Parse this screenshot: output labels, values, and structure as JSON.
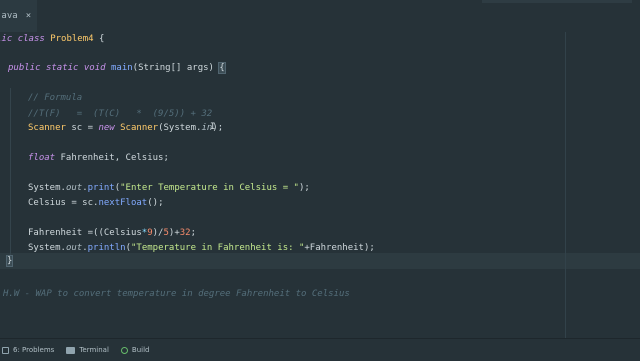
{
  "tab": {
    "name": "java",
    "close": "×"
  },
  "code": {
    "l1": {
      "a": "lic",
      "b": "class",
      "c": "Problem4",
      "d": "{"
    },
    "l2": {
      "a": "public",
      "b": "static",
      "c": "void",
      "d": "main",
      "e": "(String[] args)",
      "f": "{"
    },
    "c1": "// Formula",
    "c2": "//T(F)   =  (T(C)   *  (9/5)) + 32",
    "scanner": {
      "t": "Scanner",
      "v": " sc = ",
      "n": "new",
      "c": "Scanner",
      "a": "(System.",
      "in": "in",
      "e": ");"
    },
    "decl": {
      "t": "float",
      "v": " Fahrenheit, Celsius;"
    },
    "print": {
      "s": "System.",
      "o": "out",
      "d": ".",
      "m": "print",
      "p": "(",
      "str": "\"Enter Temperature in Celsius = \"",
      "e": ");"
    },
    "read": {
      "v": "Celsius = sc.",
      "m": "nextFloat",
      "e": "();"
    },
    "calc": {
      "a": "Fahrenheit =((Celsius",
      "op": "*",
      "n9": "9",
      "b": ")/",
      "n5": "5",
      "c": ")+",
      "n32": "32",
      "e": ";"
    },
    "println": {
      "s": "System.",
      "o": "out",
      "d": ".",
      "m": "println",
      "p": "(",
      "str": "\"Temperature in Fahrenheit is: \"",
      "e": "+Fahrenheit);"
    },
    "close": "}",
    "hw": "H.W - WAP to convert temperature in degree Fahrenheit to Celsius"
  },
  "statusbar": {
    "problems": "6: Problems",
    "terminal": "Terminal",
    "build": "Build"
  },
  "colors": {
    "background": "#263238",
    "keyword": "#c792ea",
    "class": "#ffcb6b",
    "function": "#82aaff",
    "string": "#c3e88d",
    "number": "#f78c6c",
    "comment": "#546e7a"
  }
}
